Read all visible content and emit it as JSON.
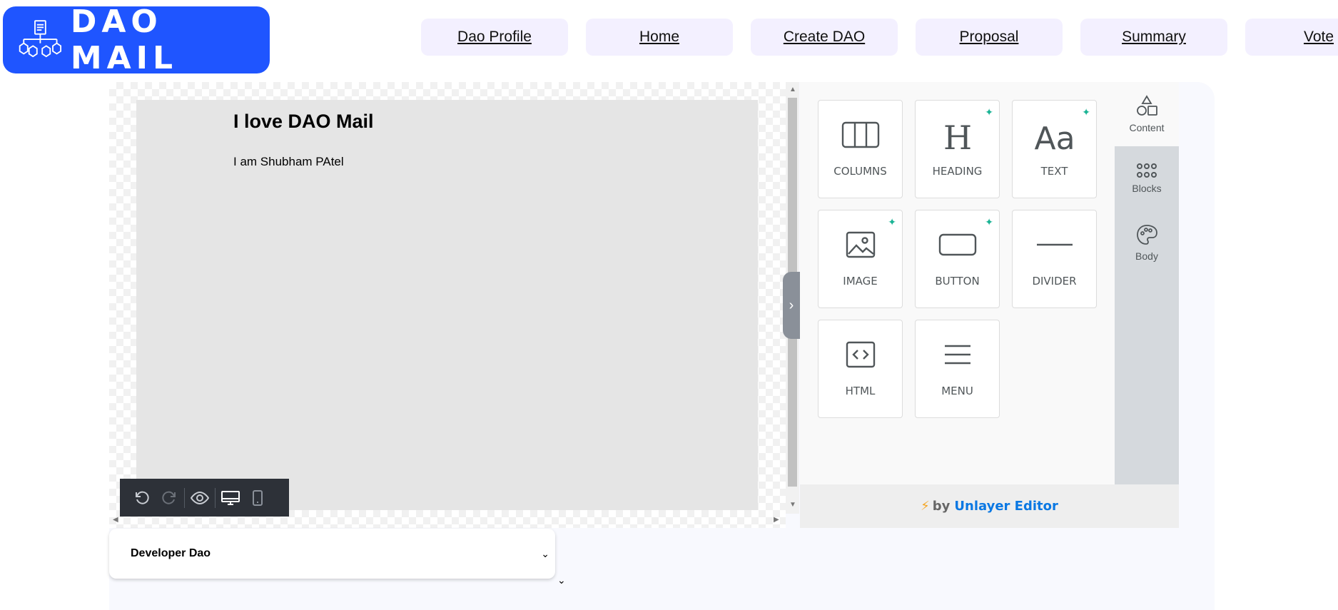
{
  "header": {
    "logo_text": "DAO MAIL",
    "nav": [
      "Dao Profile",
      "Home",
      "Create DAO",
      "Proposal",
      "Summary",
      "Vote"
    ]
  },
  "editor": {
    "heading": "I love DAO Mail",
    "text": "I am Shubham PAtel"
  },
  "tools": [
    {
      "label": "COLUMNS",
      "icon": "columns-icon",
      "ai": false
    },
    {
      "label": "HEADING",
      "icon": "heading-icon",
      "ai": true
    },
    {
      "label": "TEXT",
      "icon": "text-icon",
      "ai": true
    },
    {
      "label": "IMAGE",
      "icon": "image-icon",
      "ai": true
    },
    {
      "label": "BUTTON",
      "icon": "button-icon",
      "ai": true
    },
    {
      "label": "DIVIDER",
      "icon": "divider-icon",
      "ai": false
    },
    {
      "label": "HTML",
      "icon": "code-icon",
      "ai": false
    },
    {
      "label": "MENU",
      "icon": "menu-icon",
      "ai": false
    }
  ],
  "tabs": [
    {
      "label": "Content",
      "icon": "shapes-icon"
    },
    {
      "label": "Blocks",
      "icon": "grid-dots-icon"
    },
    {
      "label": "Body",
      "icon": "palette-icon"
    }
  ],
  "footer": {
    "by": "by",
    "brand": "Unlayer Editor"
  },
  "dao_select": {
    "value": "Developer Dao"
  },
  "colors": {
    "brand": "#1f55ff",
    "nav_bg": "#f3f0ff",
    "ai_sparkle": "#19b394",
    "unlayer_blue": "#0b78e3"
  }
}
